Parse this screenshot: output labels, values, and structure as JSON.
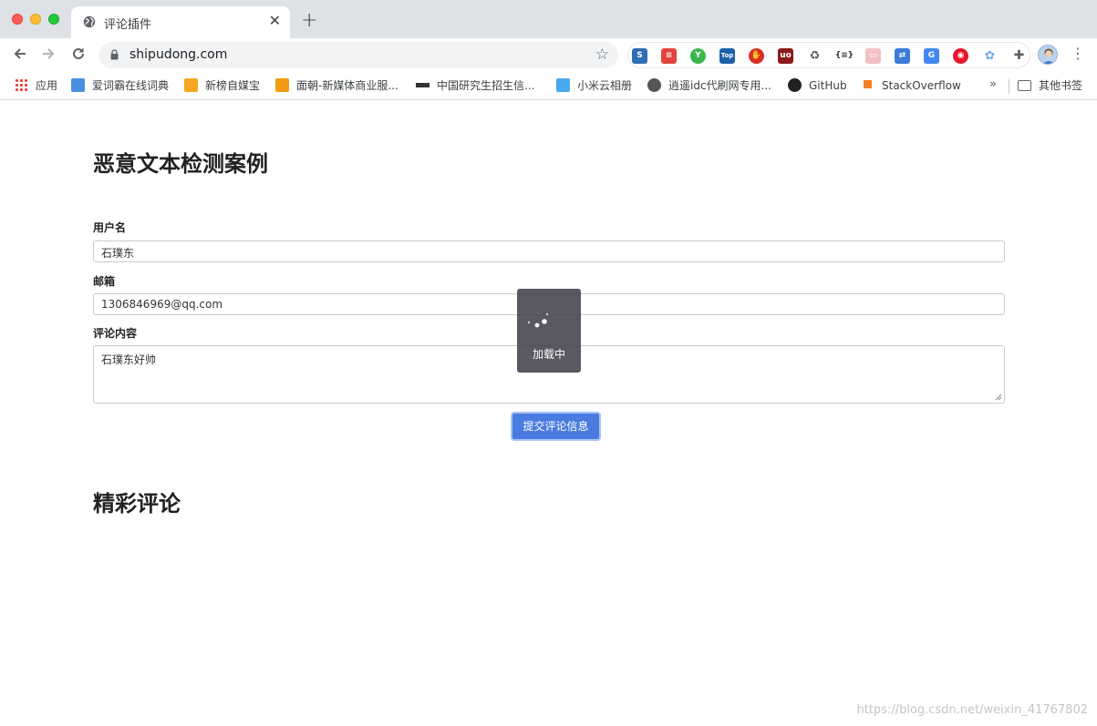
{
  "browser": {
    "tab_title": "评论插件",
    "tab_close": "✕",
    "new_tab": "+",
    "url": "shipudong.com",
    "bookmarks": [
      {
        "label": "应用",
        "color": "#e8453c"
      },
      {
        "label": "爱词霸在线词典",
        "color": "#4a90e2"
      },
      {
        "label": "新榜自媒宝",
        "color": "#f5a623"
      },
      {
        "label": "面朝-新媒体商业服...",
        "color": "#f39c12"
      },
      {
        "label": "中国研究生招生信...",
        "color": "#333333"
      },
      {
        "label": "小米云相册",
        "color": "#4aa8f0"
      },
      {
        "label": "逍遥idc代刷网专用...",
        "color": "#555555"
      },
      {
        "label": "GitHub",
        "color": "#222222"
      },
      {
        "label": "StackOverflow",
        "color": "#f48024"
      }
    ],
    "bookmarks_more": "»",
    "other_bookmarks": "其他书签"
  },
  "page": {
    "title": "恶意文本检测案例",
    "form": {
      "username_label": "用户名",
      "username_value": "石璞东",
      "email_label": "邮箱",
      "email_value": "1306846969@qq.com",
      "comment_label": "评论内容",
      "comment_value": "石璞东好帅",
      "submit_label": "提交评论信息"
    },
    "comments_title": "精彩评论",
    "loading_text": "加载中"
  },
  "watermark": "https://blog.csdn.net/weixin_41767802",
  "colors": {
    "primary_button": "#4a7be0",
    "toast_bg": "#3c3c46"
  }
}
